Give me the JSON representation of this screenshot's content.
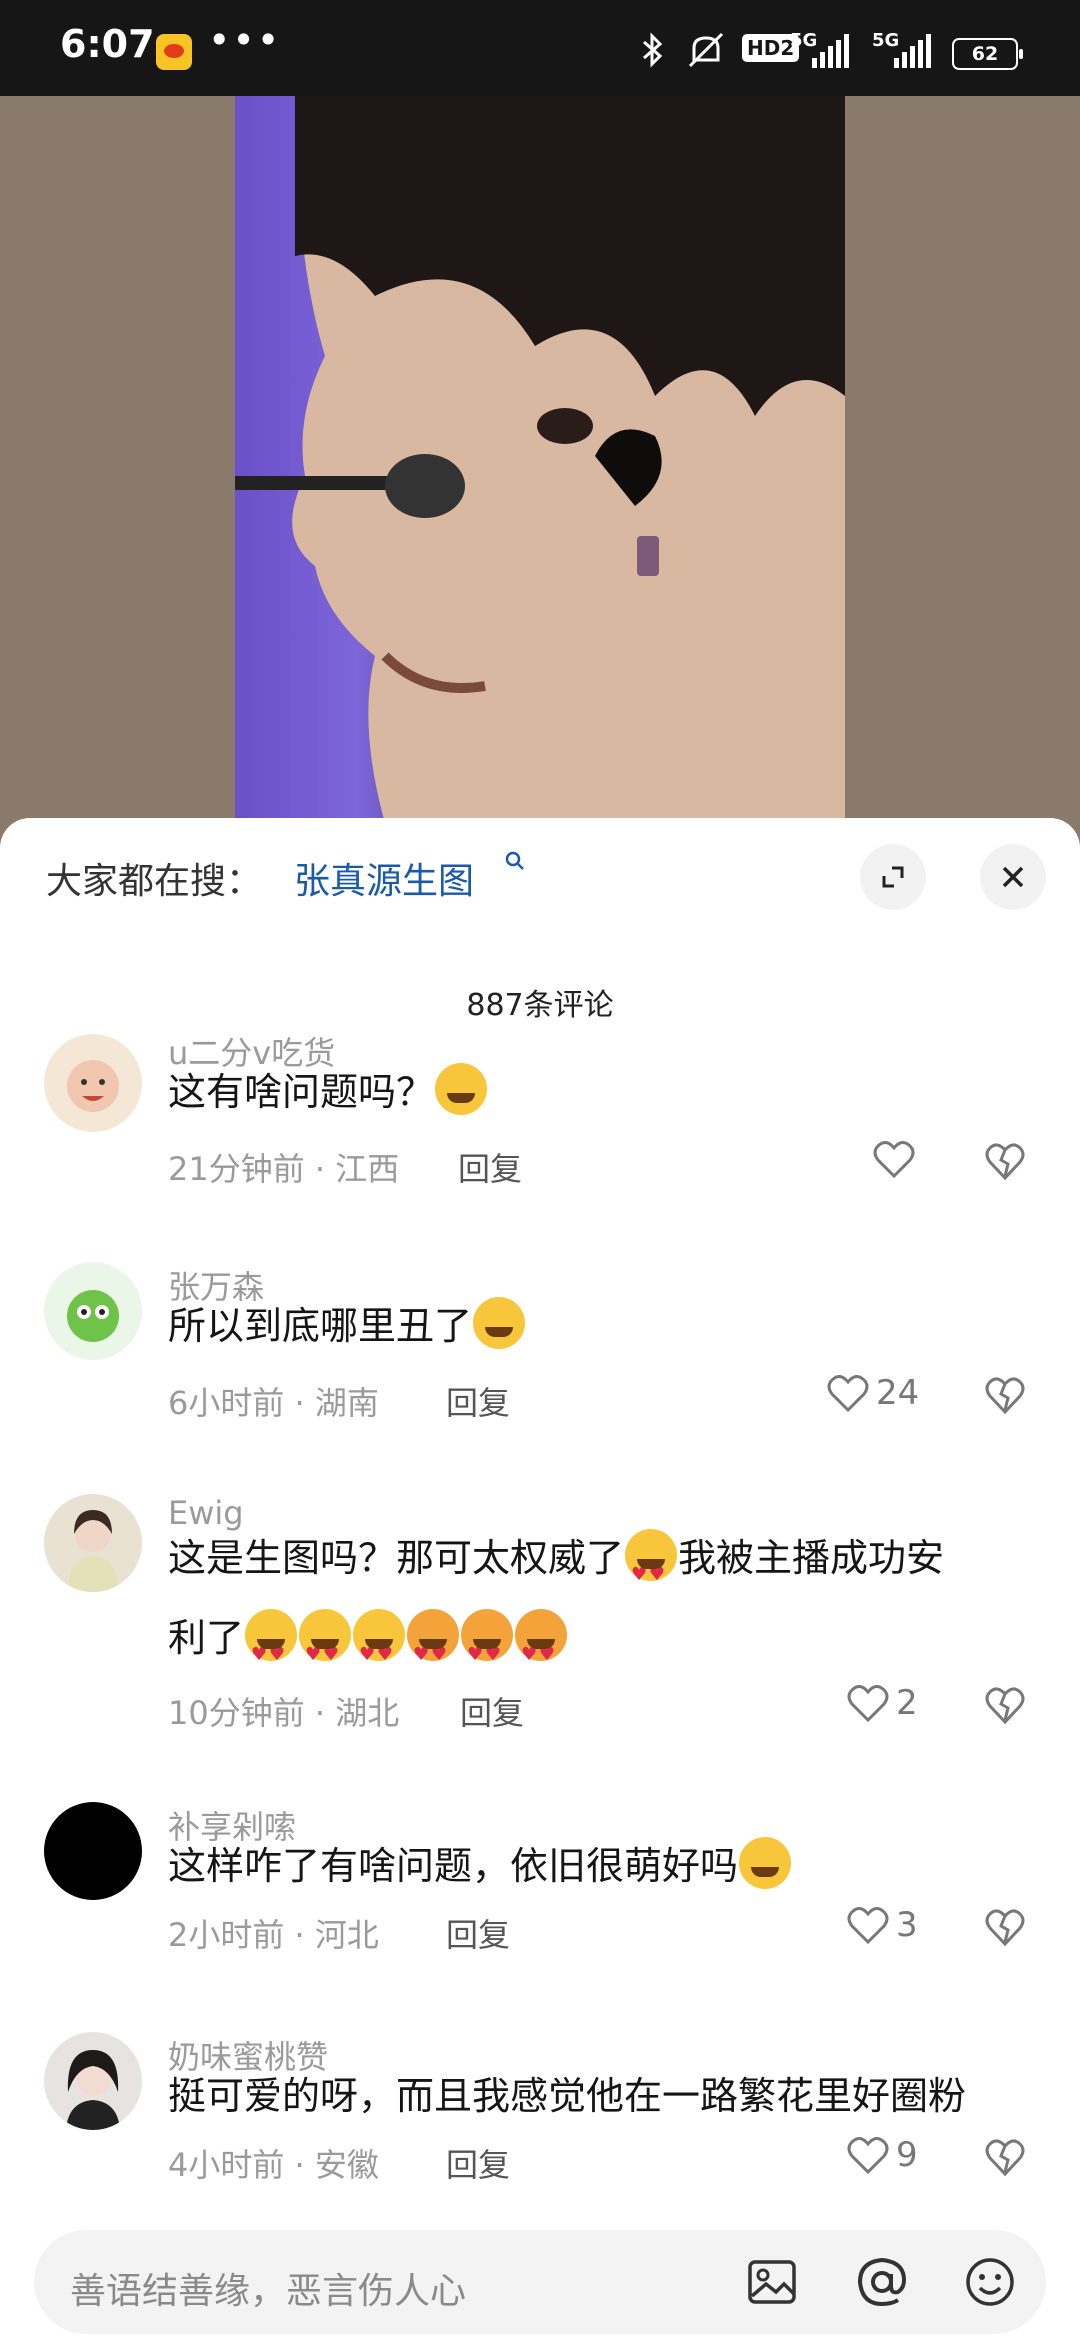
{
  "status_bar": {
    "time": "6:07",
    "dots": "•••",
    "hd": "HD2",
    "sig1": "5G",
    "sig2": "5G",
    "battery": "62"
  },
  "sheet": {
    "search_label": "大家都在搜：",
    "search_term": "张真源生图",
    "comment_count": "887条评论"
  },
  "comments": [
    {
      "user": "u二分v吃货",
      "text": "这有啥问题吗？",
      "time": "21分钟前 · 江西",
      "reply": "回复",
      "likes": ""
    },
    {
      "user": "张万森",
      "text": "所以到底哪里丑了",
      "time": "6小时前 · 湖南",
      "reply": "回复",
      "likes": "24"
    },
    {
      "user": "Ewig",
      "text": "这是生图吗？那可太权威了",
      "text2": "我被主播成功安",
      "text3": "利了",
      "time": "10分钟前 · 湖北",
      "reply": "回复",
      "likes": "2"
    },
    {
      "user": "补享剁嗦",
      "text": "这样咋了有啥问题，依旧很萌好吗",
      "time": "2小时前 · 河北",
      "reply": "回复",
      "likes": "3"
    },
    {
      "user": "奶味蜜桃赞",
      "text": "挺可爱的呀，而且我感觉他在一路繁花里好圈粉",
      "time": "4小时前 · 安徽",
      "reply": "回复",
      "likes": "9"
    }
  ],
  "input": {
    "placeholder": "善语结善缘，恶言伤人心"
  }
}
